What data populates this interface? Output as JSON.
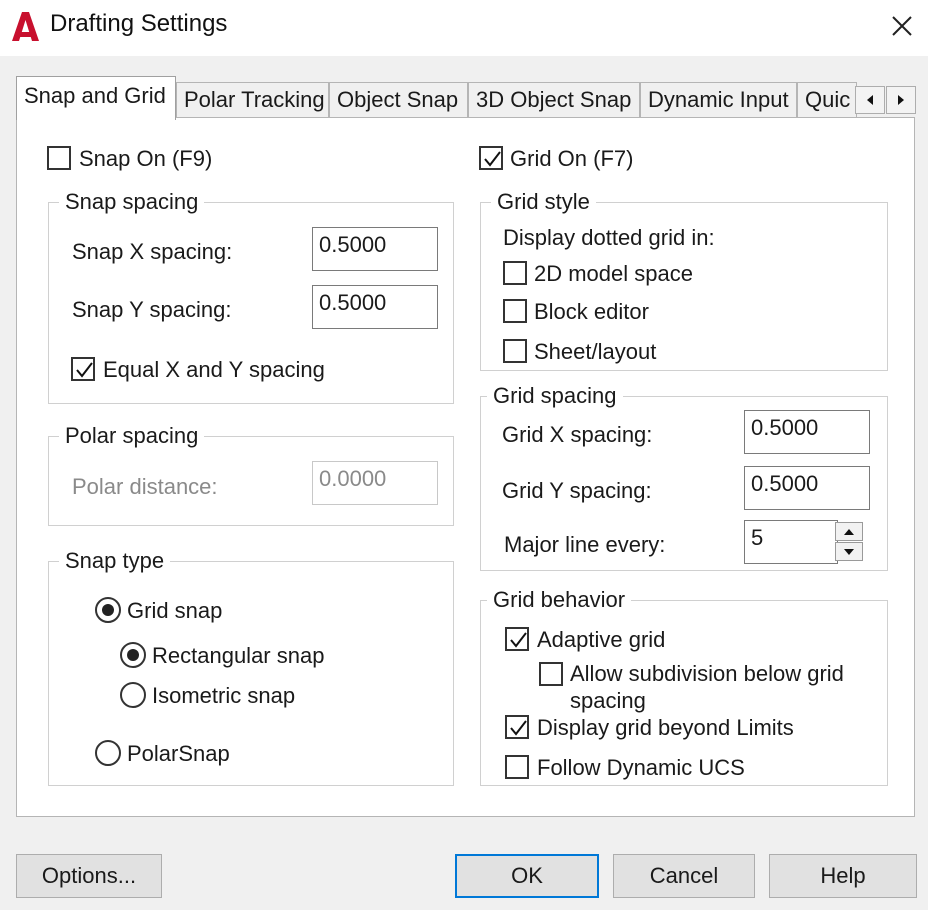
{
  "window": {
    "title": "Drafting Settings"
  },
  "tabs": [
    {
      "label": "Snap and Grid",
      "active": true
    },
    {
      "label": "Polar Tracking",
      "active": false
    },
    {
      "label": "Object Snap",
      "active": false
    },
    {
      "label": "3D Object Snap",
      "active": false
    },
    {
      "label": "Dynamic Input",
      "active": false
    },
    {
      "label": "Quic",
      "active": false
    }
  ],
  "snap": {
    "snap_on_label": "Snap On (F9)",
    "snap_on_checked": false,
    "spacing": {
      "title": "Snap spacing",
      "x_label": "Snap X spacing:",
      "x_value": "0.5000",
      "y_label": "Snap Y spacing:",
      "y_value": "0.5000",
      "equal_label": "Equal X and Y spacing",
      "equal_checked": true
    },
    "polar": {
      "title": "Polar spacing",
      "distance_label": "Polar distance:",
      "distance_value": "0.0000"
    },
    "type": {
      "title": "Snap type",
      "grid_snap": "Grid snap",
      "rectangular": "Rectangular snap",
      "isometric": "Isometric snap",
      "polarsnap": "PolarSnap"
    }
  },
  "grid": {
    "grid_on_label": "Grid On (F7)",
    "grid_on_checked": true,
    "style": {
      "title": "Grid style",
      "subtitle": "Display dotted grid in:",
      "model_space": "2D model space",
      "block_editor": "Block editor",
      "sheet_layout": "Sheet/layout"
    },
    "spacing": {
      "title": "Grid spacing",
      "x_label": "Grid X spacing:",
      "x_value": "0.5000",
      "y_label": "Grid Y spacing:",
      "y_value": "0.5000",
      "major_label": "Major line every:",
      "major_value": "5"
    },
    "behavior": {
      "title": "Grid behavior",
      "adaptive": "Adaptive grid",
      "subdivision_line1": "Allow subdivision below grid",
      "subdivision_line2": "spacing",
      "beyond_limits": "Display grid beyond Limits",
      "follow_ucs": "Follow Dynamic UCS"
    }
  },
  "buttons": {
    "options": "Options...",
    "ok": "OK",
    "cancel": "Cancel",
    "help": "Help"
  },
  "colors": {
    "accent": "#0078d7",
    "logo_red": "#c8102e"
  }
}
